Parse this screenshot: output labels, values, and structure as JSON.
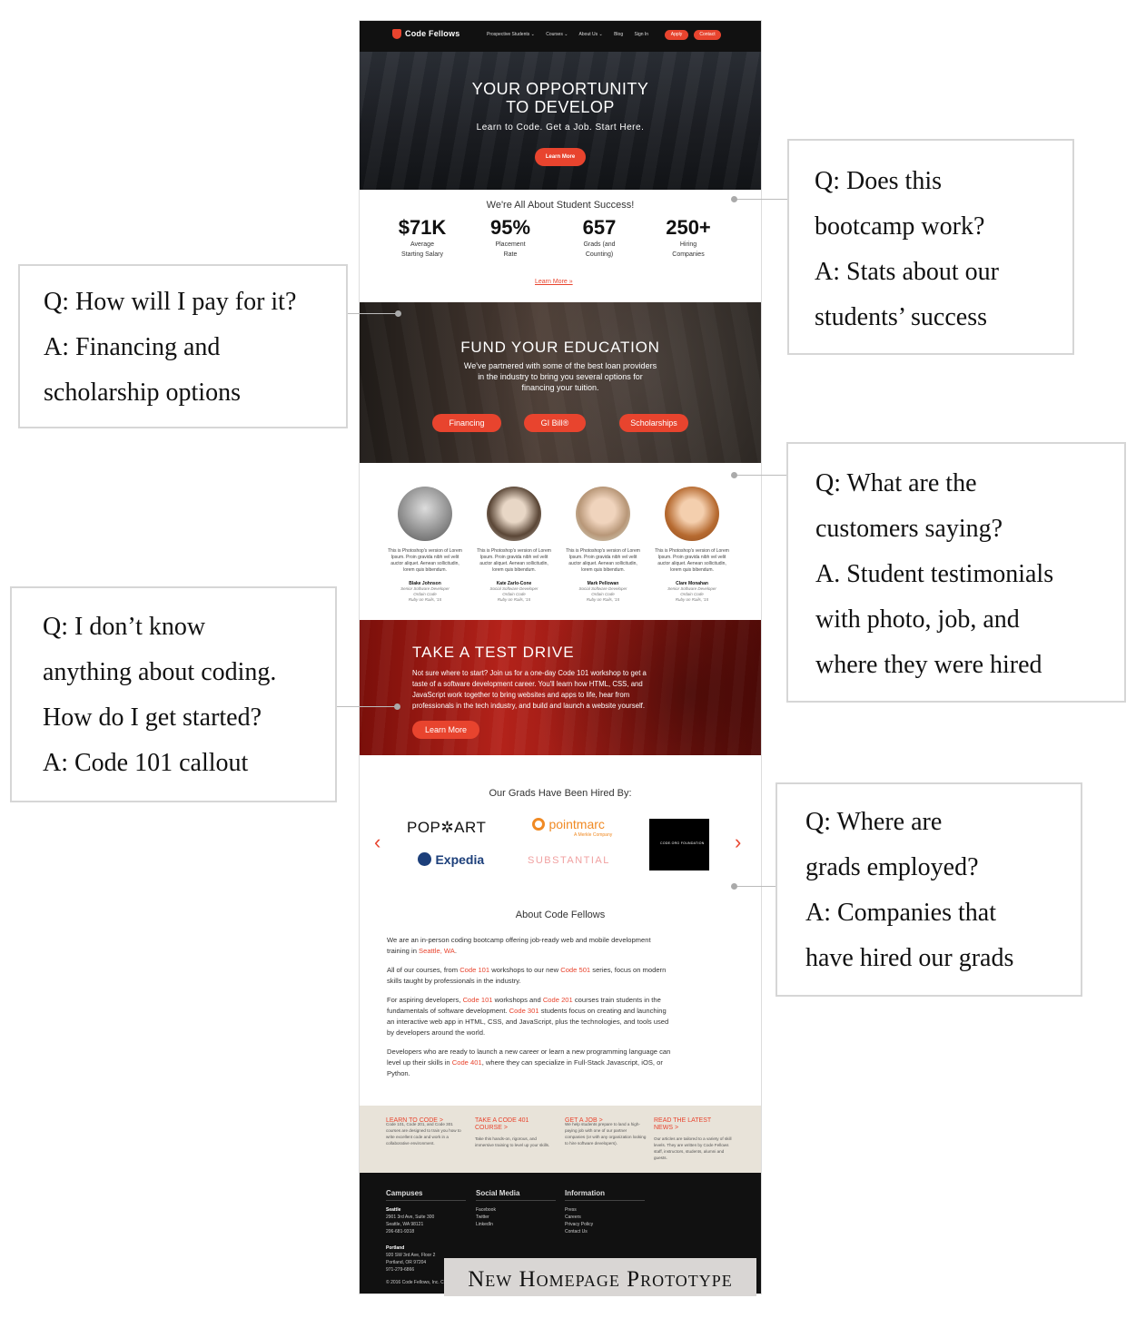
{
  "nav": {
    "brand": "Code Fellows",
    "links": [
      "Prospective Students ⌄",
      "Courses ⌄",
      "About Us ⌄",
      "Blog",
      "Sign In"
    ],
    "apply": "Apply",
    "contact": "Contact"
  },
  "hero": {
    "title_line1": "YOUR OPPORTUNITY",
    "title_line2": "TO DEVELOP",
    "subtitle": "Learn to Code. Get a Job. Start Here.",
    "button": "Learn More"
  },
  "stats": {
    "title": "We're All About Student Success!",
    "items": [
      {
        "value": "$71K",
        "label1": "Average",
        "label2": "Starting Salary"
      },
      {
        "value": "95%",
        "label1": "Placement",
        "label2": "Rate"
      },
      {
        "value": "657",
        "label1": "Grads (and",
        "label2": "Counting)"
      },
      {
        "value": "250+",
        "label1": "Hiring",
        "label2": "Companies"
      }
    ],
    "link": "Learn More »"
  },
  "fund": {
    "title": "FUND YOUR EDUCATION",
    "line1": "We've partnered with some of the best loan providers",
    "line2": "in the industry to bring you several options for",
    "line3": "financing your tuition.",
    "buttons": [
      "Financing",
      "GI Bill®",
      "Scholarships"
    ]
  },
  "testimonials": [
    {
      "quote": "This is Photoshop's version of Lorem Ipsum. Proin gravida nibh vel velit auctor aliquet. Aenean sollicitudin, lorem quis bibendum.",
      "name": "Blake Johnson",
      "job1": "Senior Software Developer",
      "job2": "Ordain Code",
      "job3": "Ruby on Rails, '15",
      "color": "#9a9a9a"
    },
    {
      "quote": "This is Photoshop's version of Lorem Ipsum. Proin gravida nibh vel velit auctor aliquet. Aenean sollicitudin, lorem quis bibendum.",
      "name": "Kate Zarlo-Cone",
      "job1": "Social Software Developer",
      "job2": "Ordain Code",
      "job3": "Ruby on Rails, '15",
      "color": "#7d6b5c"
    },
    {
      "quote": "This is Photoshop's version of Lorem Ipsum. Proin gravida nibh vel velit auctor aliquet. Aenean sollicitudin, lorem quis bibendum.",
      "name": "Mark Pellowan",
      "job1": "Social Software Developer",
      "job2": "Ordain Code",
      "job3": "Ruby on Rails, '15",
      "color": "#b8a590"
    },
    {
      "quote": "This is Photoshop's version of Lorem Ipsum. Proin gravida nibh vel velit auctor aliquet. Aenean sollicitudin, lorem quis bibendum.",
      "name": "Clare Monahan",
      "job1": "Senior Software Developer",
      "job2": "Ordain Code",
      "job3": "Ruby on Rails, '15",
      "color": "#c27a44"
    }
  ],
  "drive": {
    "title": "TAKE A TEST DRIVE",
    "line1": "Not sure where to start? Join us for  a one-day Code 101 workshop to get a",
    "line2": "taste of a software development career. You'll learn how HTML, CSS, and",
    "line3": "JavaScript work together to bring websites and apps to life, hear from",
    "line4": "professionals in the tech industry, and build and launch a website yourself.",
    "button": "Learn More"
  },
  "grads": {
    "title": "Our Grads Have Been Hired By:",
    "logos": [
      "POP✲ART",
      "pointmarc",
      "A Merkle Company",
      "Expedia",
      "SUBSTANTIAL",
      "CODE.ORG FOUNDATION"
    ]
  },
  "about": {
    "title": "About Code Fellows",
    "p1a": "We are an in-person coding bootcamp offering job-ready web and mobile development",
    "p1b": "training in ",
    "p1link": "Seattle, WA",
    "p1end": ".",
    "p2a": "All of our courses, from ",
    "p2l1": "Code 101",
    "p2b": " workshops to our new ",
    "p2l2": "Code 501",
    "p2c": " series, focus on modern",
    "p2d": "skills taught by professionals in the industry.",
    "p3a": "For aspiring developers, ",
    "p3l1": "Code 101",
    "p3b": " workshops and ",
    "p3l2": "Code 201",
    "p3c": " courses train students in the",
    "p3d": "fundamentals of software development. ",
    "p3l3": "Code 301",
    "p3e": " students focus on creating and launching",
    "p3f": "an interactive web app in HTML, CSS, and JavaScript, plus the technologies, and tools used",
    "p3g": "by developers around the world.",
    "p4a": "Developers who are ready to launch a new career or learn a new programming language can",
    "p4b": "level up their skills in ",
    "p4l": "Code 401",
    "p4c": ", where they can specialize in Full-Stack Javascript, iOS, or",
    "p4d": "Python."
  },
  "footer_cta": [
    {
      "title1": "LEARN TO CODE >",
      "title2": "",
      "desc": "Code 101, Code 201, and Code 301 courses are designed to train you how to write excellent code and work in a collaborative environment."
    },
    {
      "title1": "TAKE A CODE 401",
      "title2": "COURSE >",
      "desc": "Take this hands-on, rigorous, and immersive training to level up your skills."
    },
    {
      "title1": "GET A JOB >",
      "title2": "",
      "desc": "We help students prepare to land a high-paying job with one of our partner companies (or with any organization looking to hire software developers)."
    },
    {
      "title1": "READ THE LATEST",
      "title2": "NEWS >",
      "desc": "Our articles are tailored to a variety of skill levels. They are written by Code Fellows staff, instructors, students, alumni and guests."
    }
  ],
  "footer": {
    "campuses_title": "Campuses",
    "seattle": "Seattle",
    "seattle_addr1": "2901 3rd Ave, Suite 300",
    "seattle_addr2": "Seattle, WA 98121",
    "seattle_phone": "206-681-9318",
    "portland": "Portland",
    "portland_addr1": "920 SW 3rd Ave, Floor 2",
    "portland_addr2": "Portland, OR 97204",
    "portland_phone": "971-279-6866",
    "copyright": "© 2016 Code Fellows, Inc. Code",
    "social_title": "Social Media",
    "social": [
      "Facebook",
      "Twitter",
      "LinkedIn"
    ],
    "info_title": "Information",
    "info": [
      "Press",
      "Careers",
      "Privacy Policy",
      "Contact Us"
    ]
  },
  "callouts": {
    "stats": [
      "Q: Does this",
      "bootcamp work?",
      "A: Stats about our",
      "students’ success"
    ],
    "pay": [
      "Q: How will I pay for it?",
      "A: Financing and",
      "scholarship options"
    ],
    "testimonials": [
      "Q: What are the",
      "customers saying?",
      "A. Student testimonials",
      "with photo, job, and",
      "where they were hired"
    ],
    "coding": [
      "Q: I don’t know",
      "anything about coding.",
      "How do I get started?",
      "A: Code 101 callout"
    ],
    "employed": [
      "Q: Where are",
      "grads employed?",
      "A: Companies that",
      "have hired our grads"
    ]
  },
  "prototype_label": "New Homepage Prototype",
  "colors": {
    "accent": "#e8442e",
    "dark": "#111111",
    "cta_bg": "#e8e3d9"
  }
}
